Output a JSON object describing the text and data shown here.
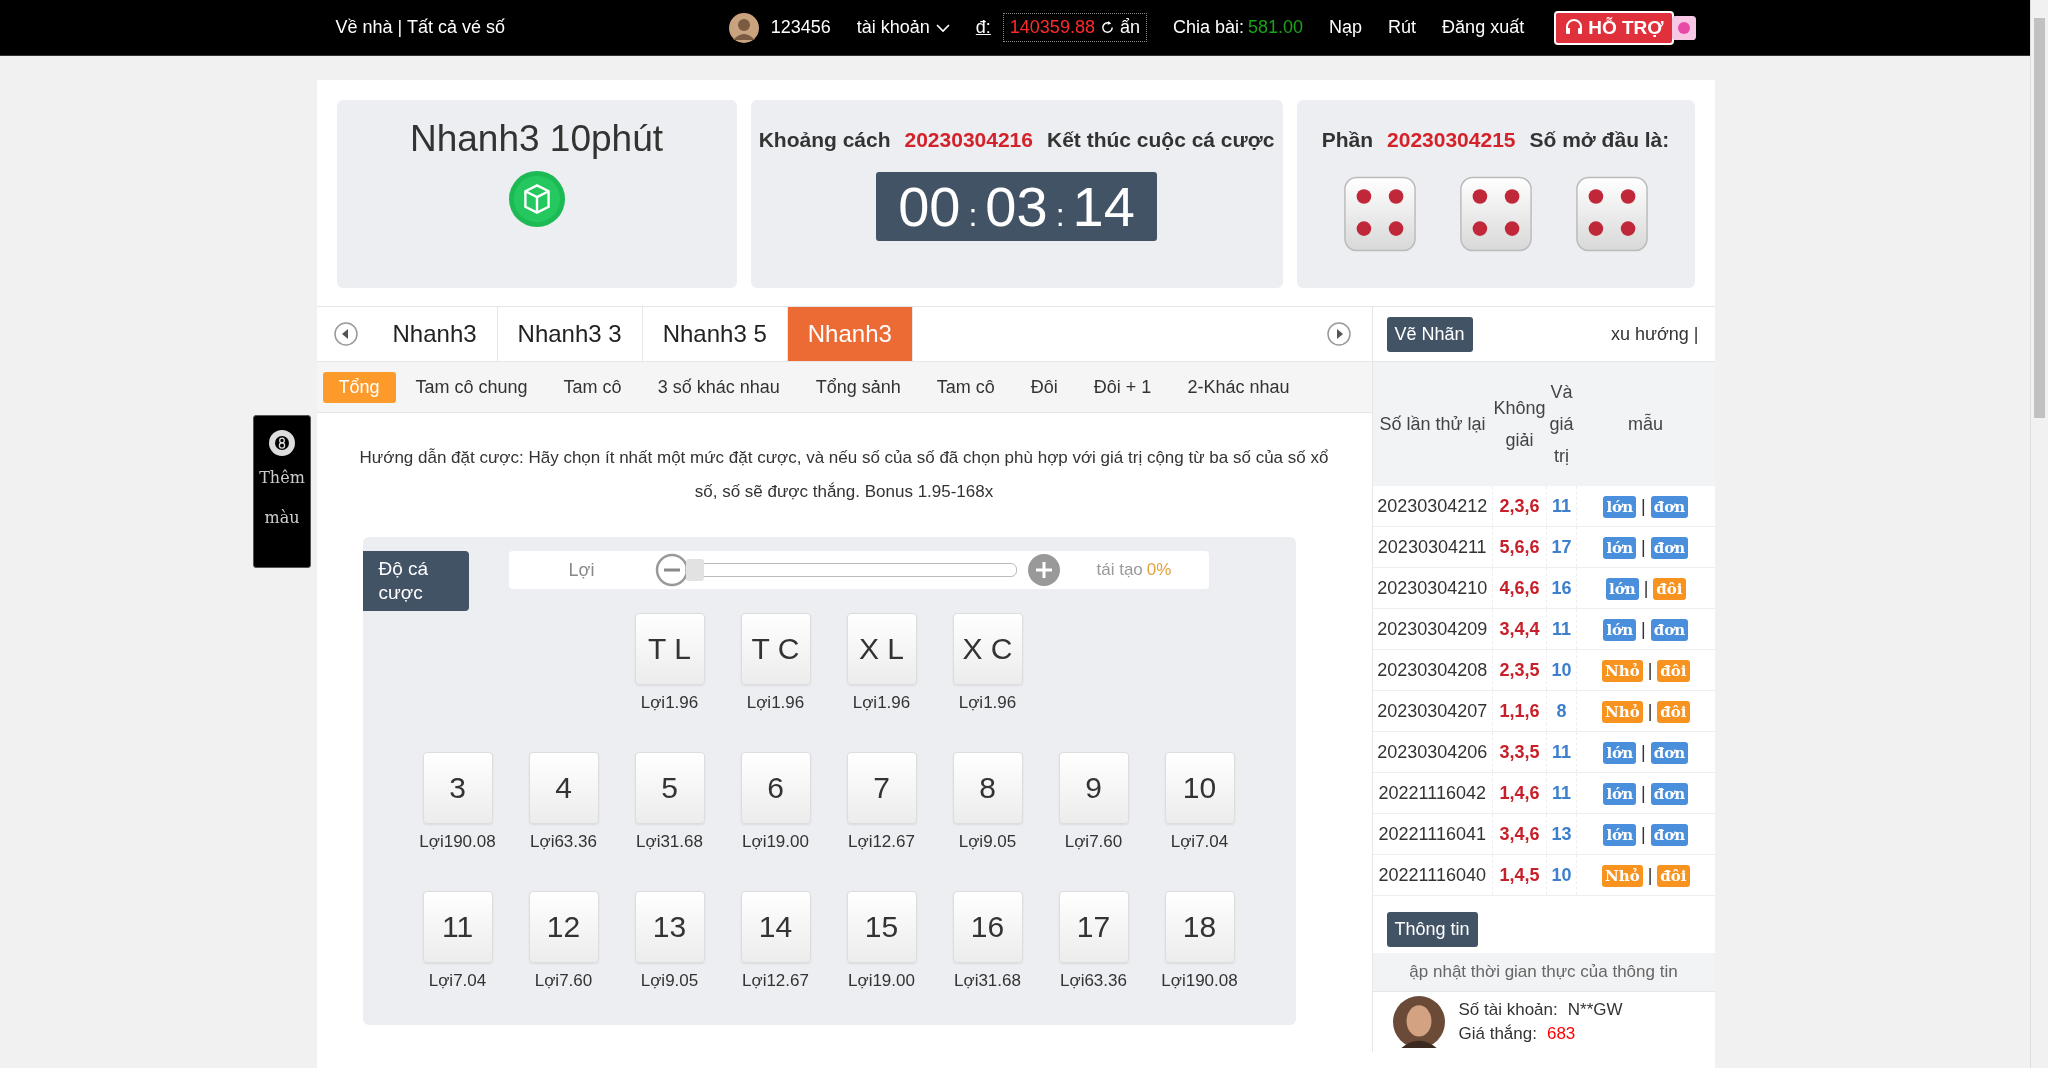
{
  "top_bar": {
    "home_link": "Về nhà | Tất cả vé số",
    "username": "123456",
    "account_menu": "tài khoản",
    "currency": "đ:",
    "balance": "140359.88",
    "hide": "ẩn",
    "deal_label": "Chia bài:",
    "deal_value": "581.00",
    "links": [
      "Nạp",
      "Rút",
      "Đăng xuất"
    ],
    "support": "HỖ TRỢ"
  },
  "game_card": {
    "title": "Nhanh3 10phút"
  },
  "countdown_card": {
    "label": "Khoảng cách",
    "issue": "20230304216",
    "suffix": "Kết thúc cuộc cá cược",
    "time": [
      "00",
      "03",
      "14"
    ],
    "separator": ":"
  },
  "result_card": {
    "label": "Phần",
    "issue": "20230304215",
    "suffix": "Số mở đầu là:",
    "dice": [
      {
        "kind": "four"
      },
      {
        "kind": "four"
      },
      {
        "kind": "four"
      }
    ]
  },
  "game_tabs": [
    {
      "label": "Nhanh3",
      "selected": false
    },
    {
      "label": "Nhanh3 3",
      "selected": false
    },
    {
      "label": "Nhanh3 5",
      "selected": false
    },
    {
      "label": "Nhanh3",
      "selected": true
    }
  ],
  "bet_types": [
    {
      "label": "Tổng",
      "selected": true
    },
    {
      "label": "Tam cô chung",
      "selected": false
    },
    {
      "label": "Tam cô",
      "selected": false
    },
    {
      "label": "3 số khác nhau",
      "selected": false
    },
    {
      "label": "Tổng sảnh",
      "selected": false
    },
    {
      "label": "Tam cô",
      "selected": false
    },
    {
      "label": "Đôi",
      "selected": false
    },
    {
      "label": "Đôi + 1",
      "selected": false
    },
    {
      "label": "2-Khác nhau",
      "selected": false
    }
  ],
  "guide": "Hướng dẫn đặt cược: Hãy chọn ít nhất một mức đặt cược, và nếu số của số đã chọn phù hợp với giá trị cộng từ ba số của số xổ số, số sẽ được thắng. Bonus 1.95-168x",
  "side_panel": {
    "tag": "Thêm màu"
  },
  "bet_panel": {
    "tag": "Độ cá cược",
    "slider_label": "Lợi",
    "level": 0,
    "rebate_label": "tái tạo",
    "rebate_value": "0%",
    "option_rows": [
      [
        {
          "label": "T L",
          "odds": "Lợi1.96"
        },
        {
          "label": "T C",
          "odds": "Lợi1.96"
        },
        {
          "label": "X L",
          "odds": "Lợi1.96"
        },
        {
          "label": "X C",
          "odds": "Lợi1.96"
        }
      ],
      [
        {
          "label": "3",
          "odds": "Lợi190.08"
        },
        {
          "label": "4",
          "odds": "Lợi63.36"
        },
        {
          "label": "5",
          "odds": "Lợi31.68"
        },
        {
          "label": "6",
          "odds": "Lợi19.00"
        },
        {
          "label": "7",
          "odds": "Lợi12.67"
        },
        {
          "label": "8",
          "odds": "Lợi9.05"
        },
        {
          "label": "9",
          "odds": "Lợi7.60"
        },
        {
          "label": "10",
          "odds": "Lợi7.04"
        }
      ],
      [
        {
          "label": "11",
          "odds": "Lợi7.04"
        },
        {
          "label": "12",
          "odds": "Lợi7.60"
        },
        {
          "label": "13",
          "odds": "Lợi9.05"
        },
        {
          "label": "14",
          "odds": "Lợi12.67"
        },
        {
          "label": "15",
          "odds": "Lợi19.00"
        },
        {
          "label": "16",
          "odds": "Lợi31.68"
        },
        {
          "label": "17",
          "odds": "Lợi63.36"
        },
        {
          "label": "18",
          "odds": "Lợi190.08"
        }
      ]
    ]
  },
  "history": {
    "draw_button": "Vẽ Nhãn",
    "trend_link": "xu hướng |",
    "columns": [
      "Số lần thử lại",
      "Không giải",
      "Và giá trị",
      "mẫu"
    ],
    "rows": [
      {
        "issue": "20230304212",
        "numbers": "2,3,6",
        "sum": "11",
        "size": {
          "text": "lớn",
          "kind": "big"
        },
        "divider": "|",
        "parity": {
          "text": "đơn",
          "kind": "odd"
        }
      },
      {
        "issue": "20230304211",
        "numbers": "5,6,6",
        "sum": "17",
        "size": {
          "text": "lớn",
          "kind": "big"
        },
        "divider": "|",
        "parity": {
          "text": "đơn",
          "kind": "odd"
        }
      },
      {
        "issue": "20230304210",
        "numbers": "4,6,6",
        "sum": "16",
        "size": {
          "text": "lớn",
          "kind": "big"
        },
        "divider": "|",
        "parity": {
          "text": "đôi",
          "kind": "even"
        }
      },
      {
        "issue": "20230304209",
        "numbers": "3,4,4",
        "sum": "11",
        "size": {
          "text": "lớn",
          "kind": "big"
        },
        "divider": "|",
        "parity": {
          "text": "đơn",
          "kind": "odd"
        }
      },
      {
        "issue": "20230304208",
        "numbers": "2,3,5",
        "sum": "10",
        "size": {
          "text": "Nhỏ",
          "kind": "small"
        },
        "divider": "|",
        "parity": {
          "text": "đôi",
          "kind": "even"
        }
      },
      {
        "issue": "20230304207",
        "numbers": "1,1,6",
        "sum": "8",
        "size": {
          "text": "Nhỏ",
          "kind": "small"
        },
        "divider": "|",
        "parity": {
          "text": "đôi",
          "kind": "even"
        }
      },
      {
        "issue": "20230304206",
        "numbers": "3,3,5",
        "sum": "11",
        "size": {
          "text": "lớn",
          "kind": "big"
        },
        "divider": "|",
        "parity": {
          "text": "đơn",
          "kind": "odd"
        }
      },
      {
        "issue": "20221116042",
        "numbers": "1,4,6",
        "sum": "11",
        "size": {
          "text": "lớn",
          "kind": "big"
        },
        "divider": "|",
        "parity": {
          "text": "đơn",
          "kind": "odd"
        }
      },
      {
        "issue": "20221116041",
        "numbers": "3,4,6",
        "sum": "13",
        "size": {
          "text": "lớn",
          "kind": "big"
        },
        "divider": "|",
        "parity": {
          "text": "đơn",
          "kind": "odd"
        }
      },
      {
        "issue": "20221116040",
        "numbers": "1,4,5",
        "sum": "10",
        "size": {
          "text": "Nhỏ",
          "kind": "small"
        },
        "divider": "|",
        "parity": {
          "text": "đôi",
          "kind": "even"
        }
      }
    ],
    "info_button": "Thông tin",
    "notice": "ập nhật thời gian thực của thông tin",
    "winner": {
      "account_label": "Số tài khoản:",
      "account": "N**GW",
      "win_label": "Giá thắng:",
      "win_value": "683"
    }
  }
}
